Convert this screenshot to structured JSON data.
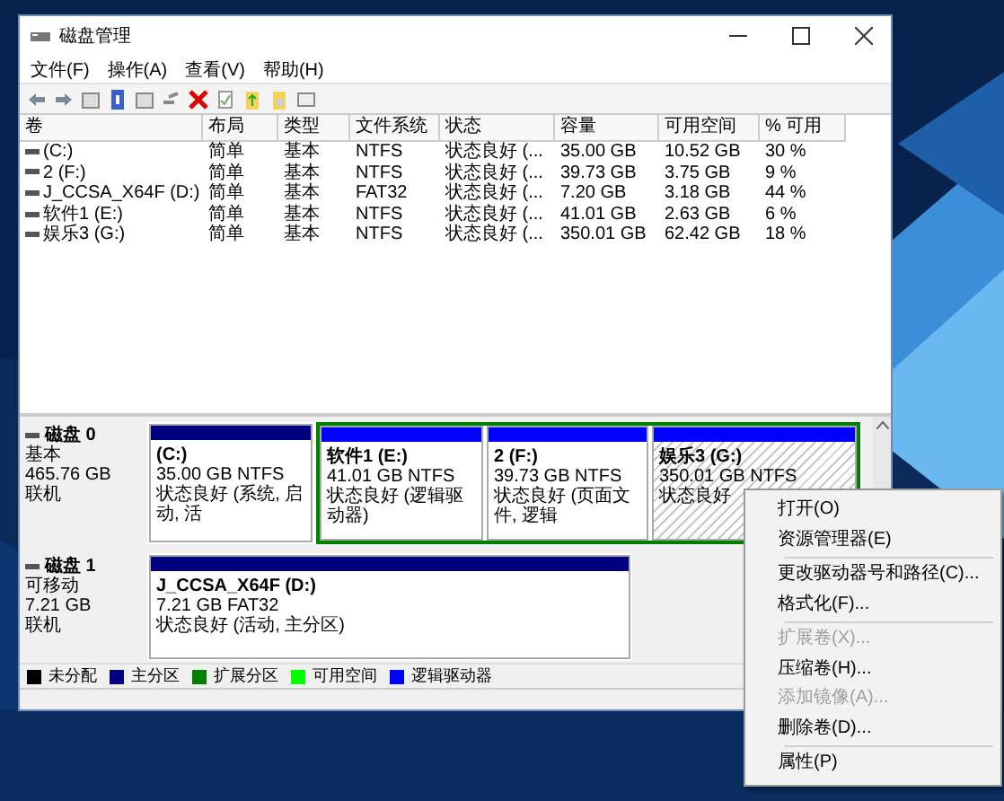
{
  "window": {
    "title": "磁盘管理"
  },
  "menu": [
    "文件(F)",
    "操作(A)",
    "查看(V)",
    "帮助(H)"
  ],
  "table": {
    "columns": [
      "卷",
      "布局",
      "类型",
      "文件系统",
      "状态",
      "容量",
      "可用空间",
      "% 可用"
    ],
    "rows": [
      [
        "(C:)",
        "简单",
        "基本",
        "NTFS",
        "状态良好 (...",
        "35.00 GB",
        "10.52 GB",
        "30 %"
      ],
      [
        "2 (F:)",
        "简单",
        "基本",
        "NTFS",
        "状态良好 (...",
        "39.73 GB",
        "3.75 GB",
        "9 %"
      ],
      [
        "J_CCSA_X64F (D:)",
        "简单",
        "基本",
        "FAT32",
        "状态良好 (...",
        "7.20 GB",
        "3.18 GB",
        "44 %"
      ],
      [
        "软件1 (E:)",
        "简单",
        "基本",
        "NTFS",
        "状态良好 (...",
        "41.01 GB",
        "2.63 GB",
        "6 %"
      ],
      [
        "娱乐3 (G:)",
        "简单",
        "基本",
        "NTFS",
        "状态良好 (...",
        "350.01 GB",
        "62.42 GB",
        "18 %"
      ]
    ]
  },
  "disks": [
    {
      "name": "磁盘 0",
      "type": "基本",
      "size": "465.76 GB",
      "status": "联机",
      "partitions": [
        {
          "kind": "primary",
          "extended": false,
          "selected": false,
          "name": "(C:)",
          "size": "35.00 GB NTFS",
          "status": "状态良好 (系统, 启动, 活"
        },
        {
          "kind": "logical",
          "extended": true,
          "selected": false,
          "name": "软件1  (E:)",
          "size": "41.01 GB NTFS",
          "status": "状态良好 (逻辑驱动器)"
        },
        {
          "kind": "logical",
          "extended": true,
          "selected": false,
          "name": "2  (F:)",
          "size": "39.73 GB NTFS",
          "status": "状态良好 (页面文件, 逻辑"
        },
        {
          "kind": "logical",
          "extended": true,
          "selected": true,
          "name": "娱乐3  (G:)",
          "size": "350.01 GB NTFS",
          "status": "状态良好"
        }
      ]
    },
    {
      "name": "磁盘 1",
      "type": "可移动",
      "size": "7.21 GB",
      "status": "联机",
      "partitions": [
        {
          "kind": "primary",
          "extended": false,
          "selected": false,
          "name": "J_CCSA_X64F  (D:)",
          "size": "7.21 GB FAT32",
          "status": "状态良好 (活动, 主分区)"
        }
      ]
    }
  ],
  "legend": [
    {
      "label": "未分配",
      "color": "#000000"
    },
    {
      "label": "主分区",
      "color": "#000080"
    },
    {
      "label": "扩展分区",
      "color": "#008000"
    },
    {
      "label": "可用空间",
      "color": "#00ff00"
    },
    {
      "label": "逻辑驱动器",
      "color": "#0000ff"
    }
  ],
  "context_menu": [
    {
      "kind": "item",
      "label": "打开(O)",
      "disabled": false
    },
    {
      "kind": "item",
      "label": "资源管理器(E)",
      "disabled": false
    },
    {
      "kind": "separator"
    },
    {
      "kind": "item",
      "label": "更改驱动器号和路径(C)...",
      "disabled": false
    },
    {
      "kind": "item",
      "label": "格式化(F)...",
      "disabled": false
    },
    {
      "kind": "separator"
    },
    {
      "kind": "item",
      "label": "扩展卷(X)...",
      "disabled": true
    },
    {
      "kind": "item",
      "label": "压缩卷(H)...",
      "disabled": false
    },
    {
      "kind": "item",
      "label": "添加镜像(A)...",
      "disabled": true
    },
    {
      "kind": "item",
      "label": "删除卷(D)...",
      "disabled": false
    },
    {
      "kind": "separator"
    },
    {
      "kind": "item",
      "label": "属性(P)",
      "disabled": false
    }
  ]
}
